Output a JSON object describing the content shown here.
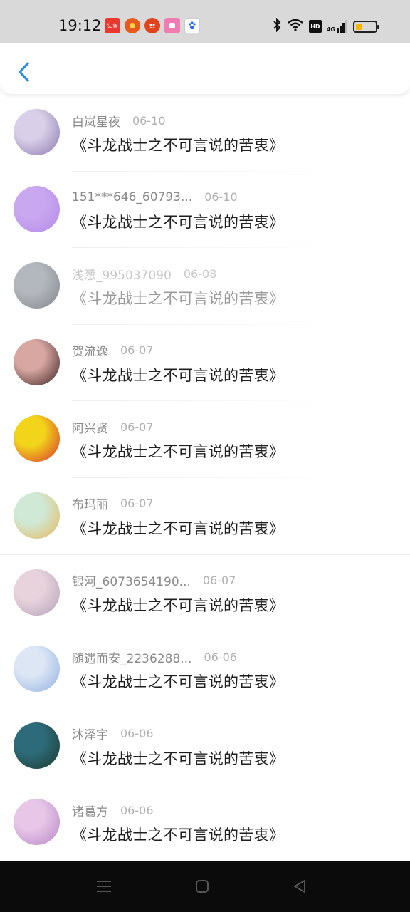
{
  "status_bar": {
    "time": "19:12",
    "notification_icons": [
      {
        "name": "toutiao-app-icon",
        "text": "头条",
        "color": "#e8382f"
      },
      {
        "name": "shopping-app-icon",
        "text": "",
        "color": "#e85a1c"
      },
      {
        "name": "taobao-app-icon",
        "text": "",
        "color": "#e0431d"
      },
      {
        "name": "pink-app-icon",
        "text": "",
        "color": "#f27bb2"
      },
      {
        "name": "baidu-app-icon",
        "text": "",
        "color": "#2f6ce8"
      }
    ],
    "hd_label": "HD",
    "network_label": "4G",
    "battery_level": 0.3,
    "battery_color": "#f5b800"
  },
  "header": {
    "back_icon": "chevron-left-icon",
    "accent_color": "#2b8ce8"
  },
  "items": [
    {
      "user": "白岚星夜",
      "date": "06-10",
      "title": "《斗龙战士之不可言说的苦衷》",
      "avatar_colors": [
        "#d9cfe8",
        "#8a78b0"
      ],
      "faded": false
    },
    {
      "user": "151***646_60793...",
      "date": "06-10",
      "title": "《斗龙战士之不可言说的苦衷》",
      "avatar_colors": [
        "#c9a8f0",
        "#b48ae8"
      ],
      "faded": false
    },
    {
      "user": "浅葱_995037090",
      "date": "06-08",
      "title": "《斗龙战士之不可言说的苦衷》",
      "avatar_colors": [
        "#9aa0a8",
        "#5a5f66"
      ],
      "faded": true
    },
    {
      "user": "贺流逸",
      "date": "06-07",
      "title": "《斗龙战士之不可言说的苦衷》",
      "avatar_colors": [
        "#d8a7a2",
        "#3a2220"
      ],
      "faded": false
    },
    {
      "user": "阿兴贤",
      "date": "06-07",
      "title": "《斗龙战士之不可言说的苦衷》",
      "avatar_colors": [
        "#f2d51a",
        "#d93030"
      ],
      "faded": false
    },
    {
      "user": "布玛丽",
      "date": "06-07",
      "title": "《斗龙战士之不可言说的苦衷》",
      "avatar_colors": [
        "#cfe9d6",
        "#e8b75a"
      ],
      "faded": false
    },
    {
      "user": "银河_6073654190...",
      "date": "06-07",
      "title": "《斗龙战士之不可言说的苦衷》",
      "avatar_colors": [
        "#e8d2dc",
        "#b2a3b8"
      ],
      "faded": false
    },
    {
      "user": "随遇而安_2236288...",
      "date": "06-06",
      "title": "《斗龙战士之不可言说的苦衷》",
      "avatar_colors": [
        "#dce6f5",
        "#8fb0e0"
      ],
      "faded": false
    },
    {
      "user": "沐泽宇",
      "date": "06-06",
      "title": "《斗龙战士之不可言说的苦衷》",
      "avatar_colors": [
        "#2e6b7a",
        "#1a3a2e"
      ],
      "faded": false
    },
    {
      "user": "诸葛方",
      "date": "06-06",
      "title": "《斗龙战士之不可言说的苦衷》",
      "avatar_colors": [
        "#e7c6e8",
        "#b587c7"
      ],
      "faded": false
    }
  ],
  "nav_bar": {
    "buttons": [
      "menu-icon",
      "home-icon",
      "back-triangle-icon"
    ]
  }
}
